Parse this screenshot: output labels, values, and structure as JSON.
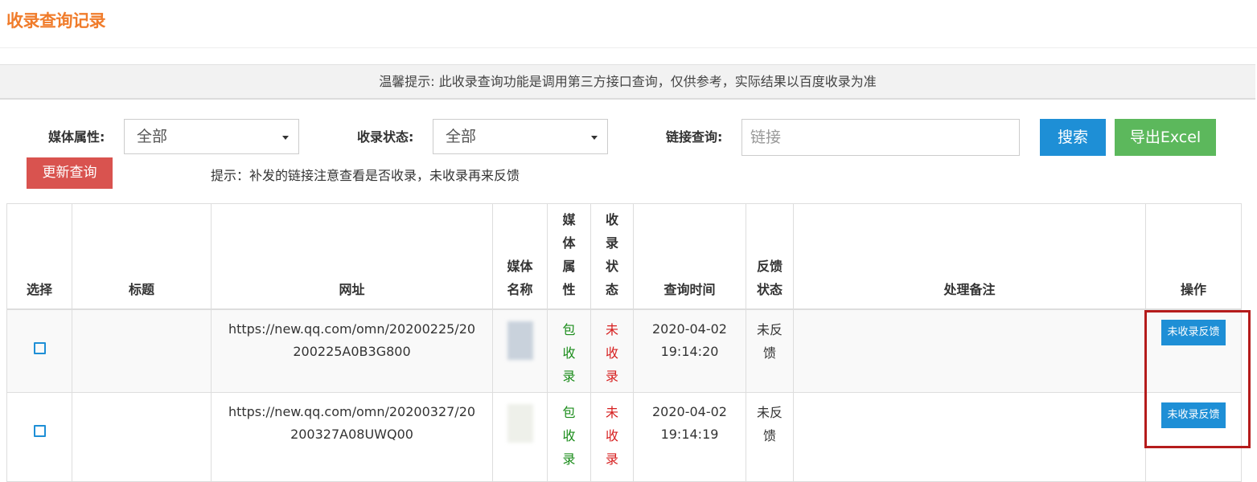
{
  "page": {
    "title": "收录查询记录"
  },
  "notice": {
    "text": "温馨提示: 此收录查询功能是调用第三方接口查询，仅供参考，实际结果以百度收录为准"
  },
  "filters": {
    "media_attr_label": "媒体属性:",
    "media_attr_value": "全部",
    "status_label": "收录状态:",
    "status_value": "全部",
    "link_label": "链接查询:",
    "link_placeholder": "链接",
    "link_value": ""
  },
  "buttons": {
    "search": "搜索",
    "export": "导出Excel",
    "refresh": "更新查询"
  },
  "tip": "提示：补发的链接注意查看是否收录，未收录再来反馈",
  "table": {
    "headers": {
      "select": "选择",
      "title": "标题",
      "url": "网址",
      "media_name": "媒体名称",
      "media_attr": "媒体属性",
      "status": "收录状态",
      "query_time": "查询时间",
      "feedback_status": "反馈状态",
      "remark": "处理备注",
      "action": "操作"
    },
    "rows": [
      {
        "title": "",
        "url": "https://new.qq.com/omn/20200225/20200225A0B3G800",
        "media_attr": "包收录",
        "status": "未收录",
        "query_time": "2020-04-02 19:14:20",
        "feedback_status": "未反馈",
        "remark": "",
        "action": "未收录反馈"
      },
      {
        "title": "",
        "url": "https://new.qq.com/omn/20200327/20200327A08UWQ00",
        "media_attr": "包收录",
        "status": "未收录",
        "query_time": "2020-04-02 19:14:19",
        "feedback_status": "未反馈",
        "remark": "",
        "action": "未收录反馈"
      }
    ]
  },
  "colors": {
    "title_orange": "#f07c2b",
    "primary_blue": "#1e8fd6",
    "success_green": "#5cb85c",
    "danger_red": "#d9534f",
    "highlight_red": "#b51c1c"
  }
}
